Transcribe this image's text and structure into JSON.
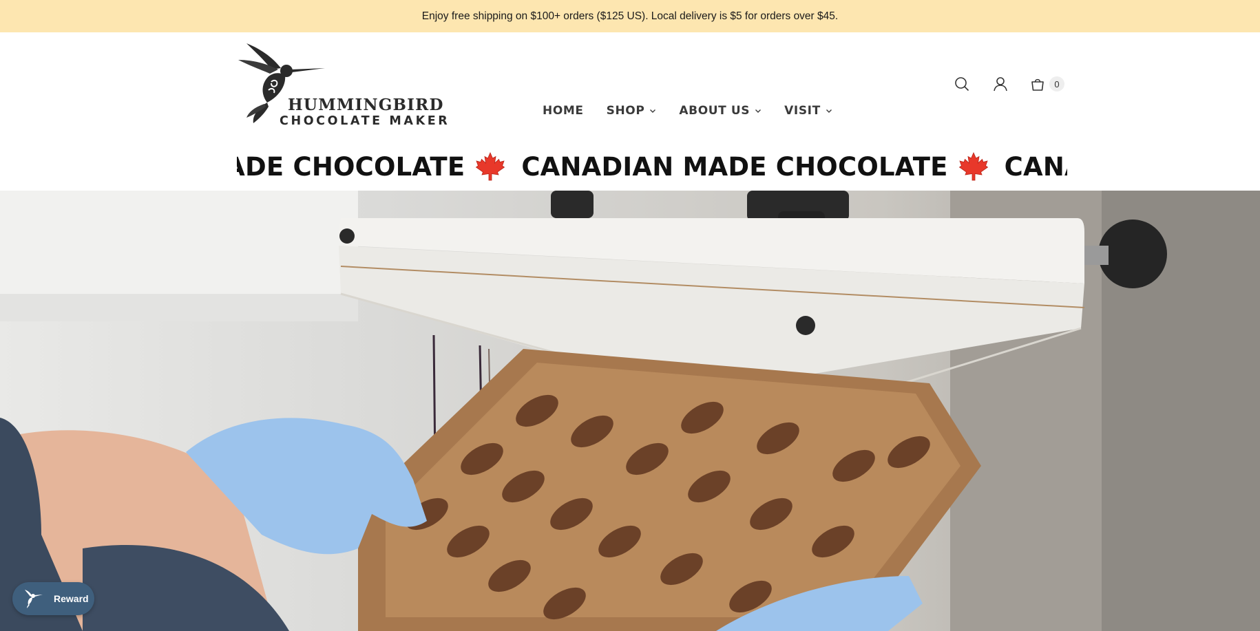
{
  "announcement": {
    "text": "Enjoy free shipping on $100+ orders ($125 US). Local delivery is $5 for orders over $45."
  },
  "header": {
    "logo": {
      "line1": "HUMMINGBIRD",
      "line2": "CHOCOLATE MAKER"
    },
    "nav": {
      "items": [
        {
          "label": "HOME",
          "has_dropdown": false
        },
        {
          "label": "SHOP",
          "has_dropdown": true
        },
        {
          "label": "ABOUT US",
          "has_dropdown": true
        },
        {
          "label": "VISIT",
          "has_dropdown": true
        }
      ]
    },
    "icons": {
      "search": "search-icon",
      "account": "account-icon",
      "cart": "cart-icon"
    },
    "cart_count": "0"
  },
  "marquee": {
    "items": [
      "CANADIAN MADE CHOCOLATE",
      "CANADIAN MADE CHOCOLATE",
      "CANADIAN MADE CHOCOLATE"
    ],
    "leaf_color": "#e8382a"
  },
  "hero": {
    "description_icon": "chocolate-depositing-photo"
  },
  "reward": {
    "label": "Reward"
  },
  "colors": {
    "announcement_bg": "#fde6b0",
    "reward_bg": "#3f5f7d"
  }
}
